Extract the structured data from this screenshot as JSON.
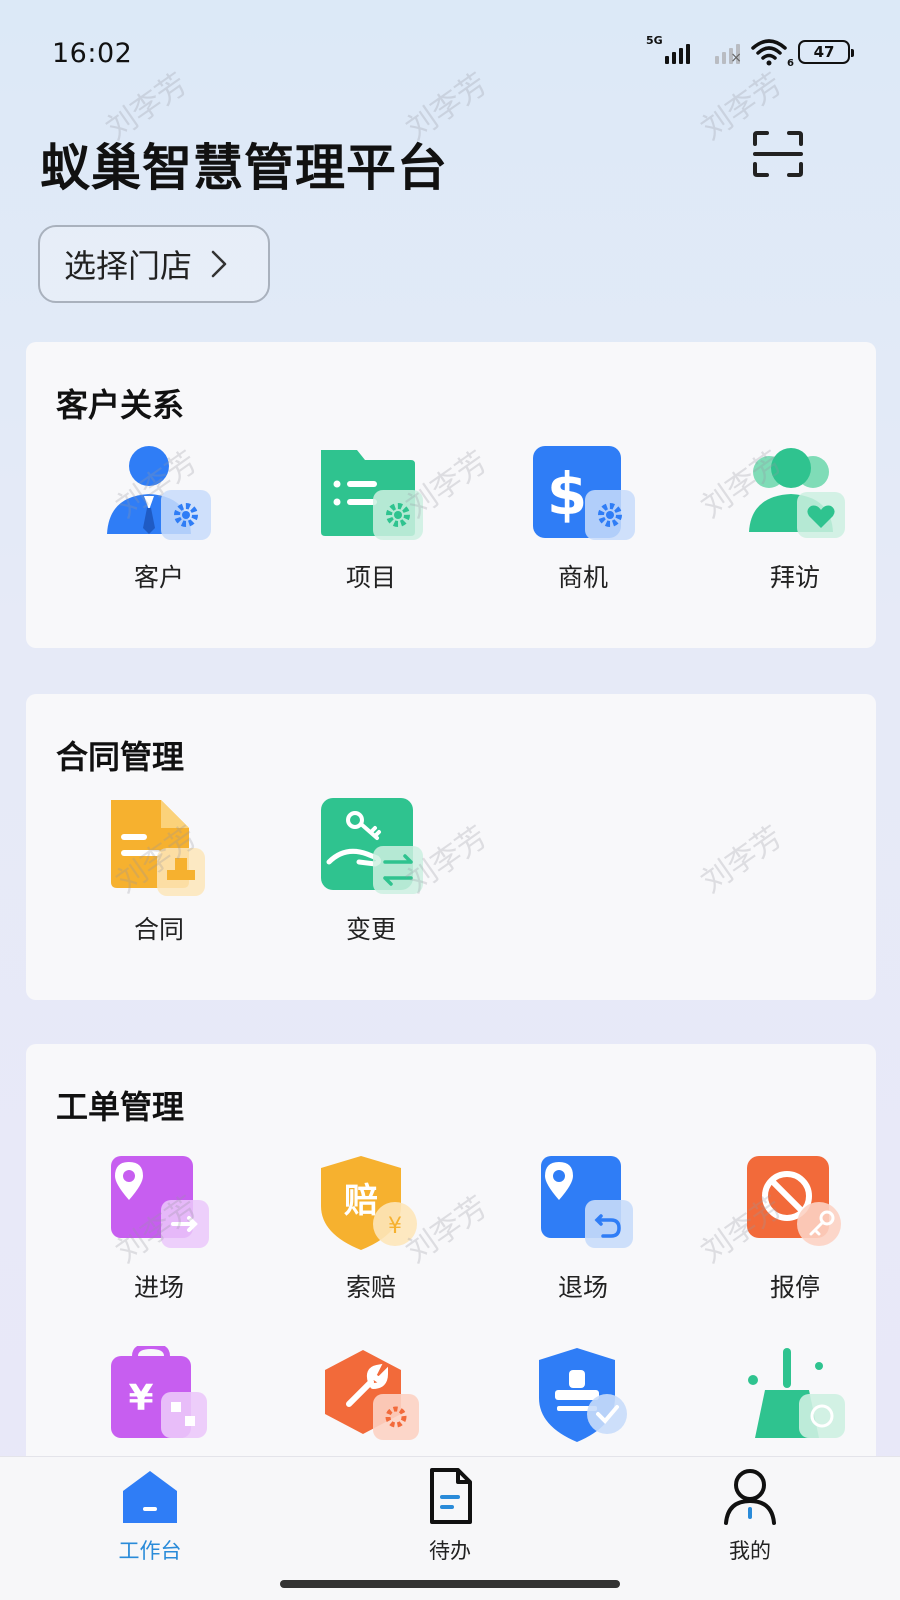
{
  "status": {
    "time": "16:02",
    "network": "5G",
    "wifi_badge": "6",
    "battery": "47"
  },
  "app": {
    "title": "蚁巢智慧管理平台",
    "scan_icon": "scan-icon"
  },
  "store_select": {
    "label": "选择门店"
  },
  "watermark": "刘李芳",
  "sections": {
    "customer": {
      "title": "客户关系",
      "items": [
        {
          "label": "客户",
          "icon": "customer-icon",
          "color": "#2f7df6"
        },
        {
          "label": "项目",
          "icon": "project-folder-icon",
          "color": "#2fc38f"
        },
        {
          "label": "商机",
          "icon": "opportunity-dollar-icon",
          "color": "#2f7df6"
        },
        {
          "label": "拜访",
          "icon": "visit-people-icon",
          "color": "#2fc38f"
        }
      ]
    },
    "contract": {
      "title": "合同管理",
      "items": [
        {
          "label": "合同",
          "icon": "contract-doc-icon",
          "color": "#f6b12f"
        },
        {
          "label": "变更",
          "icon": "change-key-icon",
          "color": "#2fc38f"
        }
      ]
    },
    "workorder": {
      "title": "工单管理",
      "items": [
        {
          "label": "进场",
          "icon": "enter-site-icon",
          "color": "#c75ef0"
        },
        {
          "label": "索赔",
          "icon": "claim-shield-icon",
          "color": "#f6b12f"
        },
        {
          "label": "退场",
          "icon": "exit-site-icon",
          "color": "#2f7df6"
        },
        {
          "label": "报停",
          "icon": "suspend-icon",
          "color": "#f26a3a"
        }
      ],
      "partial_icons": [
        "payment-clipboard-icon",
        "repair-wrench-icon",
        "approval-stamp-icon",
        "cleaning-broom-icon"
      ]
    }
  },
  "tabbar": {
    "items": [
      {
        "label": "工作台",
        "icon": "workbench-home-icon",
        "active": true
      },
      {
        "label": "待办",
        "icon": "todo-doc-icon",
        "active": false
      },
      {
        "label": "我的",
        "icon": "profile-person-icon",
        "active": false
      }
    ],
    "active_color": "#2a8bd9"
  }
}
